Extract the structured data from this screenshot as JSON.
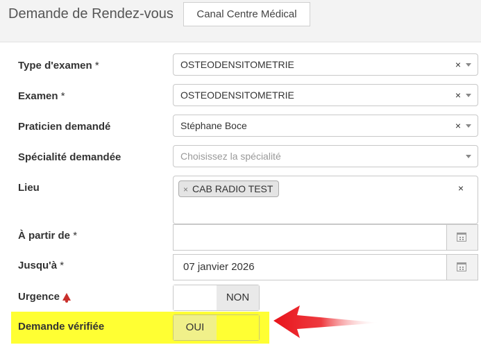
{
  "header": {
    "title": "Demande de Rendez-vous",
    "canal_button": "Canal Centre Médical"
  },
  "form": {
    "type_examen": {
      "label": "Type d'examen",
      "required": "*",
      "value": "OSTEODENSITOMETRIE",
      "clear": "×"
    },
    "examen": {
      "label": "Examen",
      "required": "*",
      "value": "OSTEODENSITOMETRIE",
      "clear": "×"
    },
    "praticien": {
      "label": "Praticien demandé",
      "value": "Stéphane Boce",
      "clear": "×"
    },
    "specialite": {
      "label": "Spécialité demandée",
      "placeholder": "Choisissez la spécialité"
    },
    "lieu": {
      "label": "Lieu",
      "tag": "CAB RADIO TEST",
      "tag_remove": "×",
      "clear": "×"
    },
    "a_partir_de": {
      "label": "À partir de",
      "required": "*",
      "value": ""
    },
    "jusqua": {
      "label": "Jusqu'à",
      "required": "*",
      "value": "07 janvier 2026"
    },
    "urgence": {
      "label": "Urgence",
      "icon": "bell-icon",
      "toggle_label": "NON",
      "state": "off"
    },
    "demande_verifiee": {
      "label": "Demande vérifiée",
      "toggle_label": "OUI",
      "state": "on"
    }
  },
  "colors": {
    "highlight": "#ffff33",
    "toggle_on": "#f0f08a",
    "toggle_off": "#e9e9e9",
    "arrow": "#e8141b",
    "bell": "#c9302c"
  }
}
